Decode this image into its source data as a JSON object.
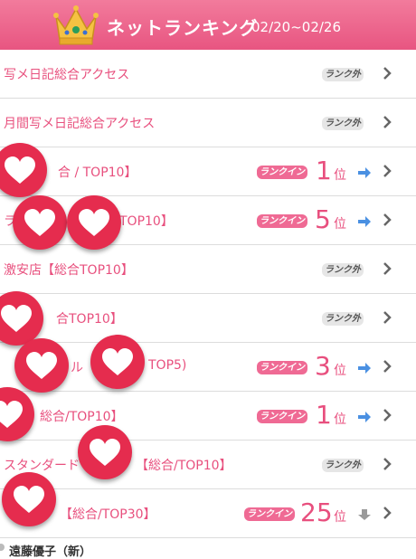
{
  "header": {
    "title": "ネットランキング",
    "date_range": "02/20~02/26"
  },
  "rows": [
    {
      "label": "写メ日記総合アクセス",
      "badge": "ランク外",
      "rank": "",
      "unit": "",
      "trend": "none"
    },
    {
      "label": "月間写メ日記総合アクセス",
      "badge": "ランク外",
      "rank": "",
      "unit": "",
      "trend": "none"
    },
    {
      "label": "合 / TOP10】",
      "badge": "ランクイン",
      "rank": "1",
      "unit": "位",
      "trend": "right"
    },
    {
      "label": "TOP10】",
      "badge": "ランクイン",
      "rank": "5",
      "unit": "位",
      "trend": "right"
    },
    {
      "label": "激安店【総合TOP10】",
      "badge": "ランク外",
      "rank": "",
      "unit": "",
      "trend": "none"
    },
    {
      "label": "合TOP10】",
      "badge": "ランク外",
      "rank": "",
      "unit": "",
      "trend": "none"
    },
    {
      "label": "TOP5)",
      "badge": "ランクイン",
      "rank": "3",
      "unit": "位",
      "trend": "right"
    },
    {
      "label": "総合/TOP10】",
      "badge": "ランクイン",
      "rank": "1",
      "unit": "位",
      "trend": "right"
    },
    {
      "label": "スタンダード",
      "label2": "【総合/TOP10】",
      "badge": "ランク外",
      "rank": "",
      "unit": "",
      "trend": "none"
    },
    {
      "label": "【総合/TOP30】",
      "badge": "ランクイン",
      "rank": "25",
      "unit": "位",
      "trend": "down"
    }
  ],
  "extra_fragments": {
    "row4_prefix": "ラ",
    "row7_prefix": "ル"
  },
  "footer": {
    "name": "遠藤優子（新）"
  },
  "colors": {
    "header_pink": "#e85581",
    "accent_pink": "#e84f7e",
    "heart_red": "#e52c4e",
    "trend_blue": "#4a90e2",
    "trend_gray": "#9a9a9a"
  }
}
